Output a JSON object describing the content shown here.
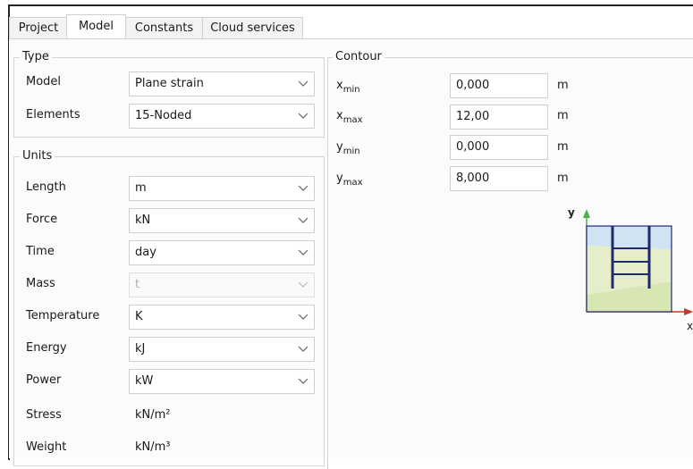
{
  "tabs": [
    {
      "label": "Project"
    },
    {
      "label": "Model"
    },
    {
      "label": "Constants"
    },
    {
      "label": "Cloud services"
    }
  ],
  "type_group": {
    "legend": "Type",
    "model_label": "Model",
    "model_value": "Plane strain",
    "elements_label": "Elements",
    "elements_value": "15-Noded"
  },
  "units_group": {
    "legend": "Units",
    "rows": [
      {
        "label": "Length",
        "value": "m"
      },
      {
        "label": "Force",
        "value": "kN"
      },
      {
        "label": "Time",
        "value": "day"
      },
      {
        "label": "Mass",
        "value": "t"
      },
      {
        "label": "Temperature",
        "value": "K"
      },
      {
        "label": "Energy",
        "value": "kJ"
      },
      {
        "label": "Power",
        "value": "kW"
      }
    ],
    "stress_label": "Stress",
    "stress_value": "kN/m²",
    "weight_label": "Weight",
    "weight_value": "kN/m³"
  },
  "contour": {
    "legend": "Contour",
    "rows": [
      {
        "var": "x",
        "sub": "min",
        "value": "0,000",
        "unit": "m"
      },
      {
        "var": "x",
        "sub": "max",
        "value": "12,00",
        "unit": "m"
      },
      {
        "var": "y",
        "sub": "min",
        "value": "0,000",
        "unit": "m"
      },
      {
        "var": "y",
        "sub": "max",
        "value": "8,000",
        "unit": "m"
      }
    ],
    "axis_y": "y",
    "axis_x": "x"
  },
  "colors": {
    "y_axis": "#4caf50",
    "x_axis": "#c0392b",
    "soil": "#e6edc9",
    "soil_dark": "#d8e6b4",
    "water": "#cfe3f2",
    "structure": "#1f2a6b"
  }
}
